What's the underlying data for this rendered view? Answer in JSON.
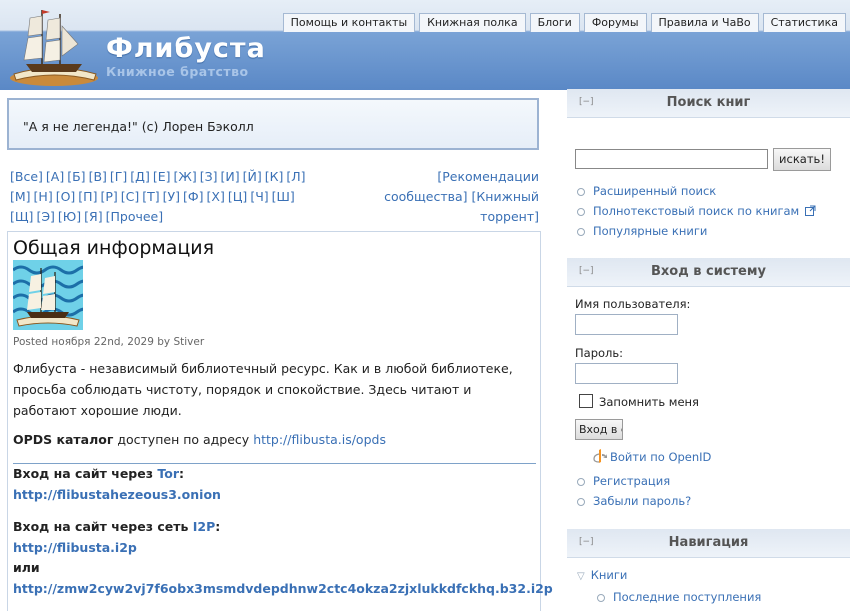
{
  "header": {
    "site_name": "Флибуста",
    "slogan": "Книжное братство",
    "tabs": [
      "Помощь и контакты",
      "Книжная полка",
      "Блоги",
      "Форумы",
      "Правила и ЧаВо",
      "Статистика"
    ]
  },
  "quote": "\"А я не легенда!\" (с) Лорен Бэколл",
  "alphabet": [
    "[Все]",
    "[А]",
    "[Б]",
    "[В]",
    "[Г]",
    "[Д]",
    "[Е]",
    "[Ж]",
    "[З]",
    "[И]",
    "[Й]",
    "[К]",
    "[Л]",
    "[М]",
    "[Н]",
    "[О]",
    "[П]",
    "[Р]",
    "[С]",
    "[Т]",
    "[У]",
    "[Ф]",
    "[Х]",
    "[Ц]",
    "[Ч]",
    "[Ш]",
    "[Щ]",
    "[Э]",
    "[Ю]",
    "[Я]",
    "[Прочее]"
  ],
  "side_links": {
    "recommendations": "[Рекомендации сообщества]",
    "torrent": "[Книжный торрент]"
  },
  "article": {
    "title": "Общая информация",
    "posted": "Posted ноября 22nd, 2029 by Stiver",
    "intro": "Флибуста - независимый библиотечный ресурс. Как и в любой библиотеке, просьба соблюдать чистоту, порядок и спокойствие. Здесь читают и работают хорошие люди.",
    "opds_label": "OPDS каталог",
    "opds_text": " доступен по адресу ",
    "opds_url": "http://flibusta.is/opds",
    "tor_label": "Вход на сайт через ",
    "tor_word": "Tor",
    "tor_colon": ":",
    "tor_link": "http://flibustahezeous3.onion",
    "i2p_label": "Вход на сайт через сеть ",
    "i2p_word": "I2P",
    "i2p_colon": ":",
    "i2p_link": "http://flibusta.i2p",
    "or_label": "или",
    "i2p_long": "http://zmw2cyw2vj7f6obx3msmdvdepdhnw2ctc4okza2zjxlukkdfckhq.b32.i2p"
  },
  "sidebar": {
    "search": {
      "title": "Поиск книг",
      "collapse": "[−]",
      "button": "искать!",
      "links": [
        "Расширенный поиск",
        "Полнотекстовый поиск по книгам",
        "Популярные книги"
      ]
    },
    "login": {
      "title": "Вход в систему",
      "collapse": "[−]",
      "username_label": "Имя пользователя:",
      "password_label": "Пароль:",
      "remember": "Запомнить меня",
      "button": "Вход в систему",
      "openid": "Войти по OpenID",
      "links": [
        "Регистрация",
        "Забыли пароль?"
      ]
    },
    "nav": {
      "title": "Навигация",
      "collapse": "[−]",
      "items": [
        "Книги",
        "Последние поступления"
      ]
    }
  },
  "colors": {
    "link": "#3a70b5",
    "header_blue": "#5b8bc9",
    "sidebar_title_bg": "#e6edf5"
  }
}
